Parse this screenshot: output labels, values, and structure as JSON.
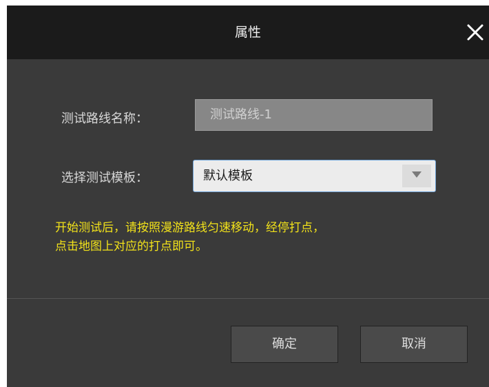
{
  "dialog": {
    "title": "属性",
    "close_icon": "close-icon"
  },
  "form": {
    "route_name_label": "测试路线名称：",
    "route_name_value": "测试路线-1",
    "template_label": "选择测试模板：",
    "template_selected": "默认模板",
    "dropdown_icon": "triangle-down-icon"
  },
  "hint": {
    "line1": "开始测试后，请按照漫游路线匀速移动，经停打点，",
    "line2": "点击地图上对应的打点即可。"
  },
  "footer": {
    "ok_label": "确定",
    "cancel_label": "取消"
  },
  "colors": {
    "title_bar": "#1b1b1b",
    "body": "#3a3a3a",
    "hint_text": "#f2e21a",
    "select_border": "#6ea3d8"
  }
}
